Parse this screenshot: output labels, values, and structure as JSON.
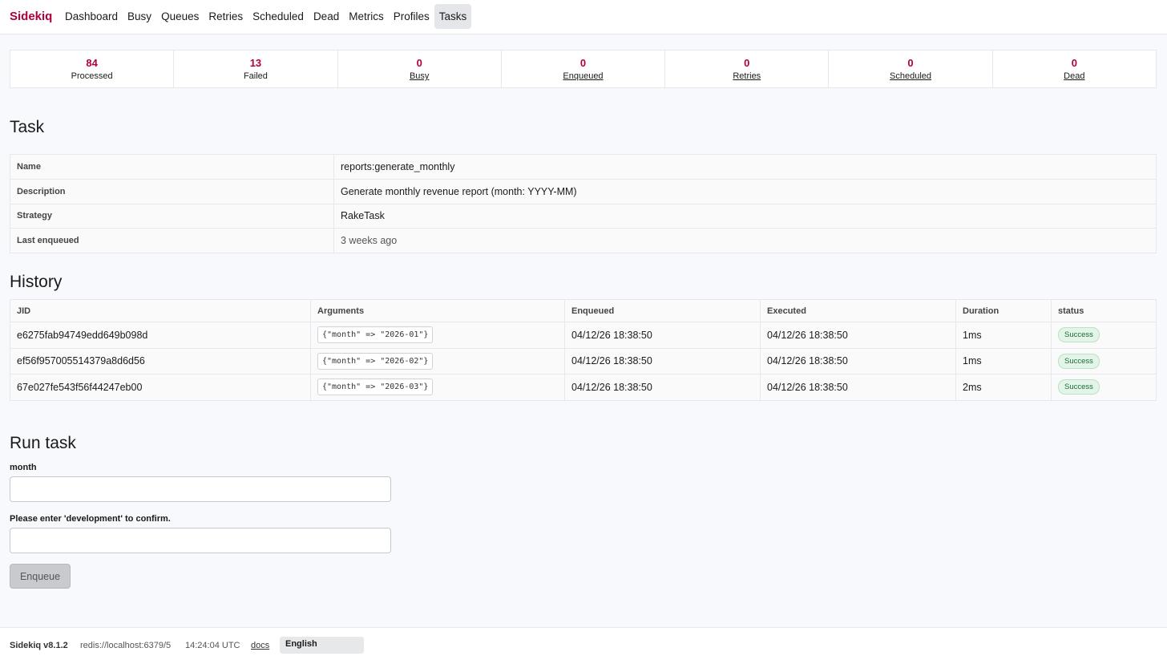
{
  "nav": {
    "brand": "Sidekiq",
    "links": [
      "Dashboard",
      "Busy",
      "Queues",
      "Retries",
      "Scheduled",
      "Dead",
      "Metrics",
      "Profiles",
      "Tasks"
    ],
    "active": "Tasks"
  },
  "stats": [
    {
      "value": "84",
      "label": "Processed"
    },
    {
      "value": "13",
      "label": "Failed"
    },
    {
      "value": "0",
      "label": "Busy"
    },
    {
      "value": "0",
      "label": "Enqueued"
    },
    {
      "value": "0",
      "label": "Retries"
    },
    {
      "value": "0",
      "label": "Scheduled"
    },
    {
      "value": "0",
      "label": "Dead"
    }
  ],
  "task": {
    "heading": "Task",
    "rows": [
      {
        "key": "Name",
        "value": "reports:generate_monthly"
      },
      {
        "key": "Description",
        "value": "Generate monthly revenue report (month: YYYY-MM)"
      },
      {
        "key": "Strategy",
        "value": "RakeTask"
      },
      {
        "key": "Last enqueued",
        "value": "3 weeks ago"
      }
    ]
  },
  "history": {
    "heading": "History",
    "columns": [
      "JID",
      "Arguments",
      "Enqueued",
      "Executed",
      "Duration",
      "status"
    ],
    "rows": [
      {
        "jid": "e6275fab94749edd649b098d",
        "args": "{\"month\" => \"2026-01\"}",
        "enqueued": "04/12/26 18:38:50",
        "executed": "04/12/26 18:38:50",
        "duration": "1ms",
        "status": "Success"
      },
      {
        "jid": "ef56f957005514379a8d6d56",
        "args": "{\"month\" => \"2026-02\"}",
        "enqueued": "04/12/26 18:38:50",
        "executed": "04/12/26 18:38:50",
        "duration": "1ms",
        "status": "Success"
      },
      {
        "jid": "67e027fe543f56f44247eb00",
        "args": "{\"month\" => \"2026-03\"}",
        "enqueued": "04/12/26 18:38:50",
        "executed": "04/12/26 18:38:50",
        "duration": "2ms",
        "status": "Success"
      }
    ]
  },
  "run": {
    "heading": "Run task",
    "month_label": "month",
    "month_value": "",
    "confirm_label": "Please enter 'development' to confirm.",
    "confirm_value": "",
    "button": "Enqueue"
  },
  "footer": {
    "version": "Sidekiq v8.1.2",
    "redis": "redis://localhost:6379/5",
    "time": "14:24:04 UTC",
    "docs": "docs",
    "language": "English"
  },
  "colors": {
    "brand": "#b1003e",
    "success_bg": "#e3f5e8",
    "success_text": "#1d6b35"
  }
}
